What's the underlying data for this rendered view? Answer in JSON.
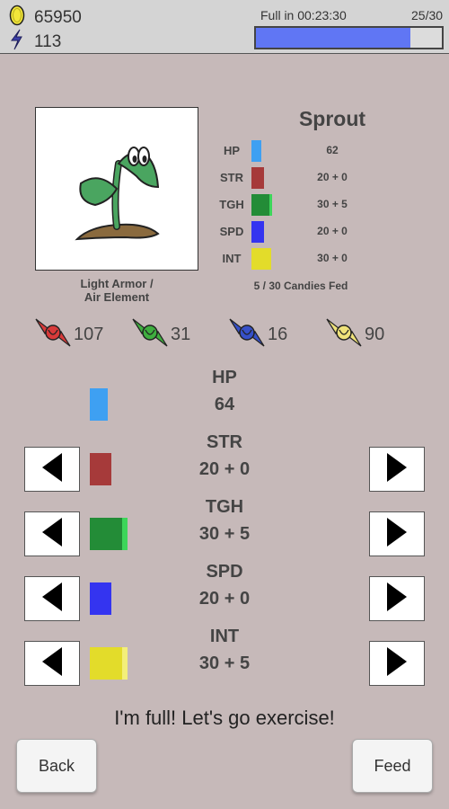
{
  "currency": {
    "coins": "65950",
    "gems": "113",
    "coin_icon": "gold-coin-icon",
    "gem_icon": "crystal-icon"
  },
  "fullness": {
    "timer_label": "Full in 00:23:30",
    "count_label": "25/30",
    "fraction": 0.833,
    "bar_color": "#6076f4"
  },
  "pet": {
    "name": "Sprout",
    "element": "Light Armor / Air Element",
    "element_line1": "Light Armor /",
    "element_line2": "Air Element",
    "candies_fed": "5 / 30 Candies Fed",
    "icon": "sprout-plant-icon"
  },
  "mini_stats": [
    {
      "label": "HP",
      "value": "62",
      "color": "#3ea0f2",
      "extra_color": null
    },
    {
      "label": "STR",
      "value": "20 + 0",
      "color": "#a63a3a",
      "extra_color": null
    },
    {
      "label": "TGH",
      "value": "30 + 5",
      "color": "#238c37",
      "extra_color": "#3dd65a"
    },
    {
      "label": "SPD",
      "value": "20 + 0",
      "color": "#3434f0",
      "extra_color": null
    },
    {
      "label": "INT",
      "value": "30 + 0",
      "color": "#e3dc2a",
      "extra_color": null
    }
  ],
  "candies": [
    {
      "name": "red-candy",
      "count": "107",
      "color": "#d83a3a"
    },
    {
      "name": "green-candy",
      "count": "31",
      "color": "#3fae3f"
    },
    {
      "name": "blue-candy",
      "count": "16",
      "color": "#3650c8"
    },
    {
      "name": "yellow-candy",
      "count": "90",
      "color": "#efe27a"
    }
  ],
  "stats": [
    {
      "label": "HP",
      "value": "64",
      "color": "#3ea0f2",
      "extra_color": null,
      "has_arrows": false
    },
    {
      "label": "STR",
      "value": "20 + 0",
      "color": "#a63a3a",
      "extra_color": null,
      "has_arrows": true
    },
    {
      "label": "TGH",
      "value": "30 + 5",
      "color": "#238c37",
      "extra_color": "#3dd65a",
      "has_arrows": true
    },
    {
      "label": "SPD",
      "value": "20 + 0",
      "color": "#3434f0",
      "extra_color": null,
      "has_arrows": true
    },
    {
      "label": "INT",
      "value": "30 + 5",
      "color": "#e3dc2a",
      "extra_color": "#f3ef7a",
      "has_arrows": true
    }
  ],
  "message": "I'm full!  Let's go exercise!",
  "buttons": {
    "back": "Back",
    "feed": "Feed"
  }
}
